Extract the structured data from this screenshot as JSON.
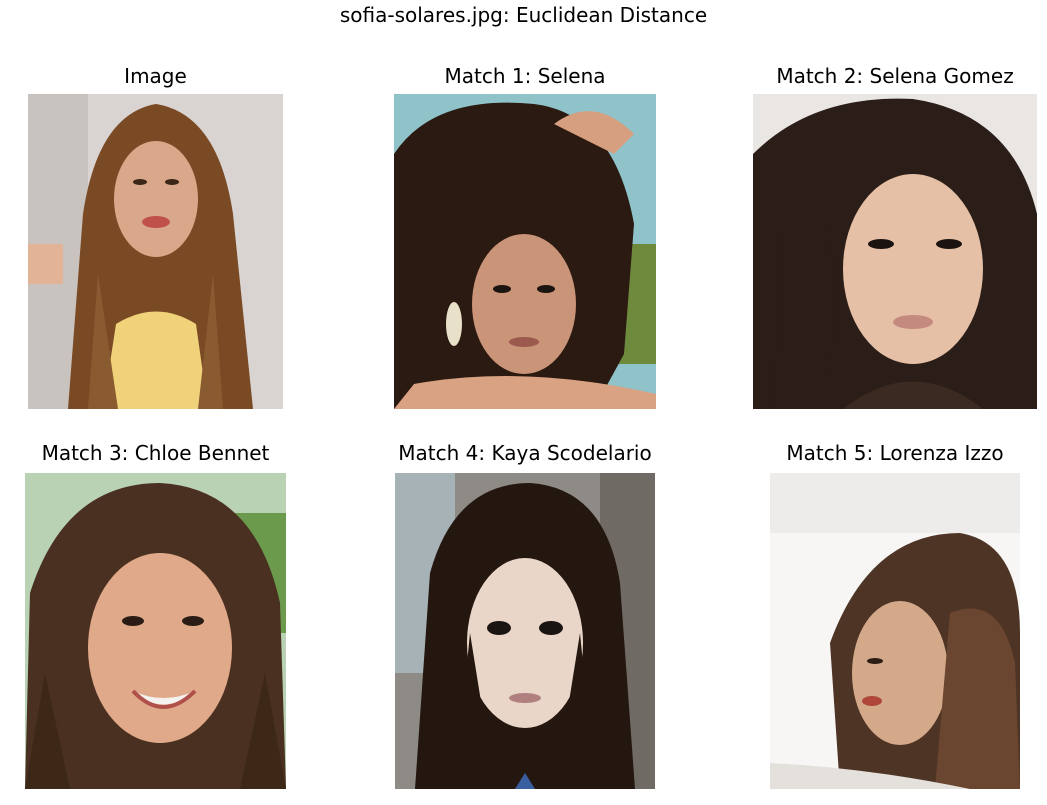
{
  "figure": {
    "suptitle": "sofia-solares.jpg: Euclidean Distance"
  },
  "panels": [
    {
      "title": "Image",
      "photo_icon": "portrait-photo"
    },
    {
      "title": "Match 1: Selena",
      "photo_icon": "portrait-photo"
    },
    {
      "title": "Match 2: Selena Gomez",
      "photo_icon": "portrait-photo"
    },
    {
      "title": "Match 3: Chloe Bennet",
      "photo_icon": "portrait-photo"
    },
    {
      "title": "Match 4: Kaya Scodelario",
      "photo_icon": "portrait-photo"
    },
    {
      "title": "Match 5: Lorenza Izzo",
      "photo_icon": "portrait-photo"
    }
  ],
  "colors": {
    "background": "#ffffff",
    "text": "#000000"
  }
}
